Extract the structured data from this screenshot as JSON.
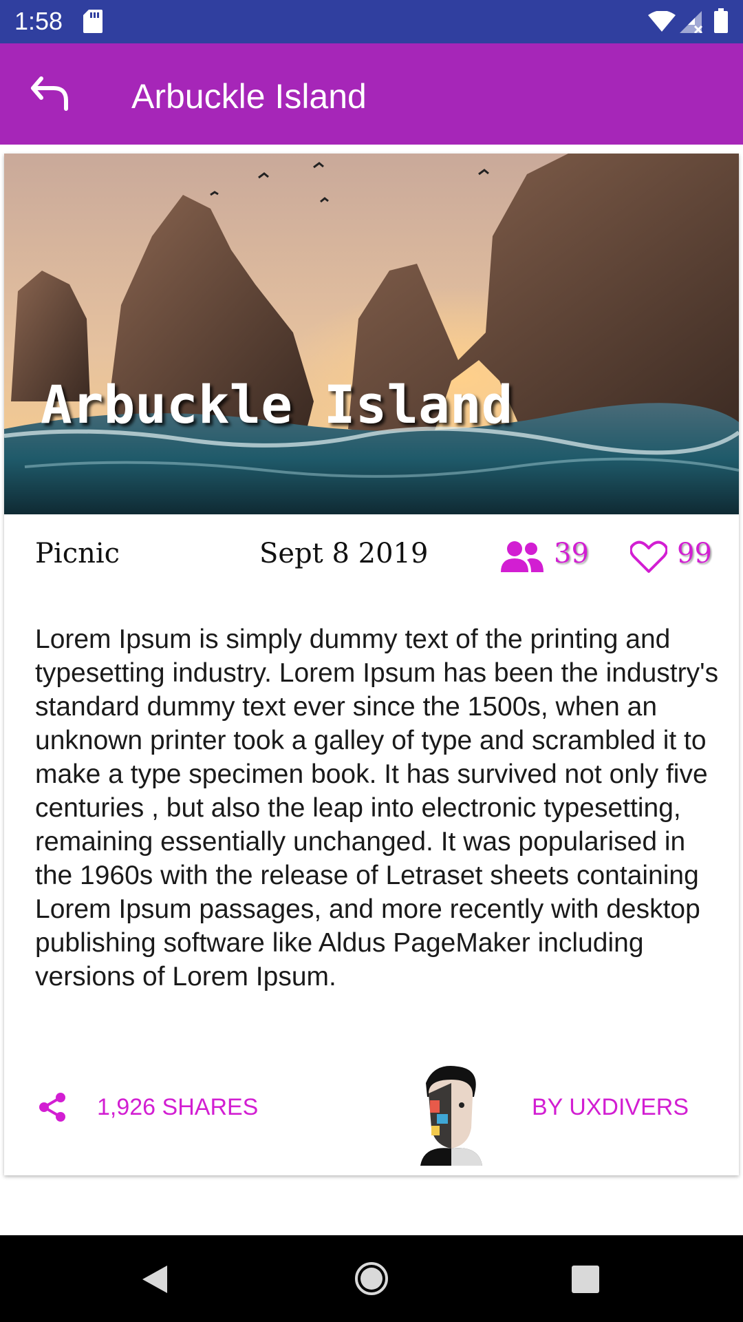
{
  "status_bar": {
    "time": "1:58",
    "icons": [
      "sd-card-icon",
      "wifi-icon",
      "signal-icon",
      "battery-icon"
    ]
  },
  "app_bar": {
    "title": "Arbuckle Island",
    "back_icon": "back-arrow-icon"
  },
  "card": {
    "hero_title": "Arbuckle Island",
    "category": "Picnic",
    "date": "Sept 8 2019",
    "attendees": "39",
    "likes": "99",
    "body": "Lorem Ipsum is simply dummy text of the printing and typesetting industry. Lorem Ipsum has been the industry's standard dummy text ever since the 1500s, when an unknown printer took a galley of type and scrambled it to make a type specimen book. It has survived not only five centuries , but also the leap into electronic typesetting, remaining essentially unchanged. It was popularised in the 1960s with the release of Letraset sheets containing Lorem Ipsum passages, and more recently with desktop publishing software like Aldus PageMaker including versions of Lorem Ipsum.",
    "shares": "1,926 SHARES",
    "author": "BY UXDIVERS"
  },
  "colors": {
    "status_bar": "#303f9f",
    "app_bar": "#a626b8",
    "accent": "#d21ed2"
  },
  "nav_bar": {
    "icons": [
      "back-triangle-icon",
      "home-circle-icon",
      "recents-square-icon"
    ]
  }
}
